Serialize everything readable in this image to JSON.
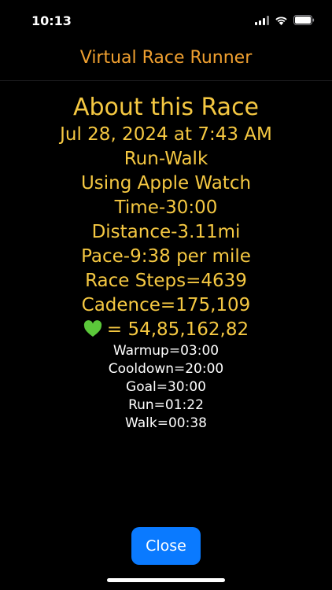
{
  "status_bar": {
    "time": "10:13",
    "icons": [
      "signal-icon",
      "wifi-icon",
      "battery-icon"
    ]
  },
  "nav": {
    "title": "Virtual Race Runner"
  },
  "race": {
    "heading": "About this Race",
    "date": "Jul 28, 2024 at 7:43 AM",
    "mode": "Run-Walk",
    "device": "Using Apple Watch",
    "time": "Time-30:00",
    "distance": "Distance-3.11mi",
    "pace": "Pace-9:38 per mile",
    "steps": "Race Steps=4639",
    "cadence": "Cadence=175,109",
    "heart_rate": "= 54,85,162,82",
    "warmup": "Warmup=03:00",
    "cooldown": "Cooldown=20:00",
    "goal": "Goal=30:00",
    "run": "Run=01:22",
    "walk": "Walk=00:38"
  },
  "buttons": {
    "close_label": "Close"
  },
  "colors": {
    "background": "#000000",
    "title_orange": "#f0a030",
    "content_yellow": "#f5c842",
    "button_blue": "#0a7aff",
    "heart_green": "#5bc83a"
  }
}
